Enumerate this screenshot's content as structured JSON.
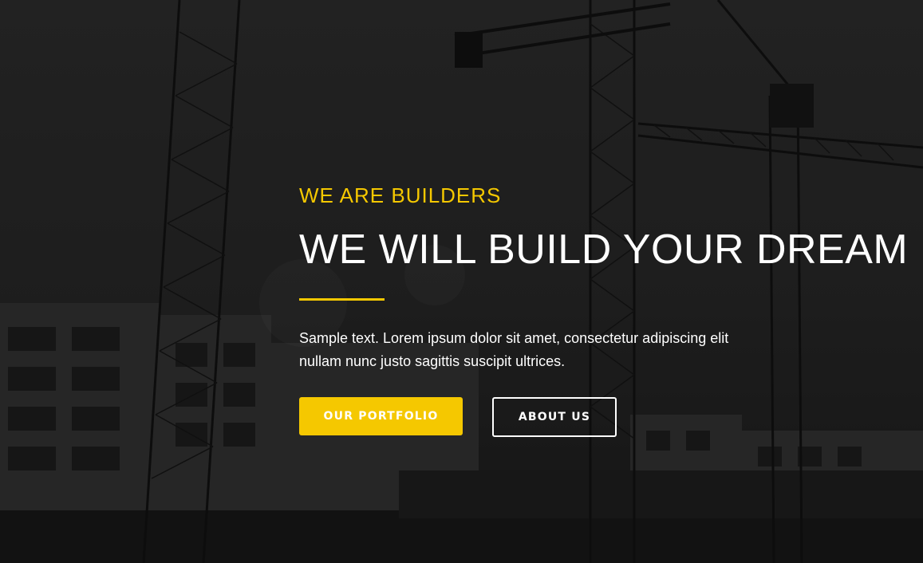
{
  "hero": {
    "eyebrow": "WE ARE BUILDERS",
    "headline": "WE WILL BUILD YOUR DREAM",
    "description": "Sample text. Lorem ipsum dolor sit amet, consectetur adipiscing elit nullam nunc justo sagittis suscipit ultrices.",
    "primary_button": "OUR PORTFOLIO",
    "secondary_button": "ABOUT US"
  },
  "colors": {
    "accent": "#f5c800",
    "text": "#ffffff",
    "background": "#242424"
  }
}
